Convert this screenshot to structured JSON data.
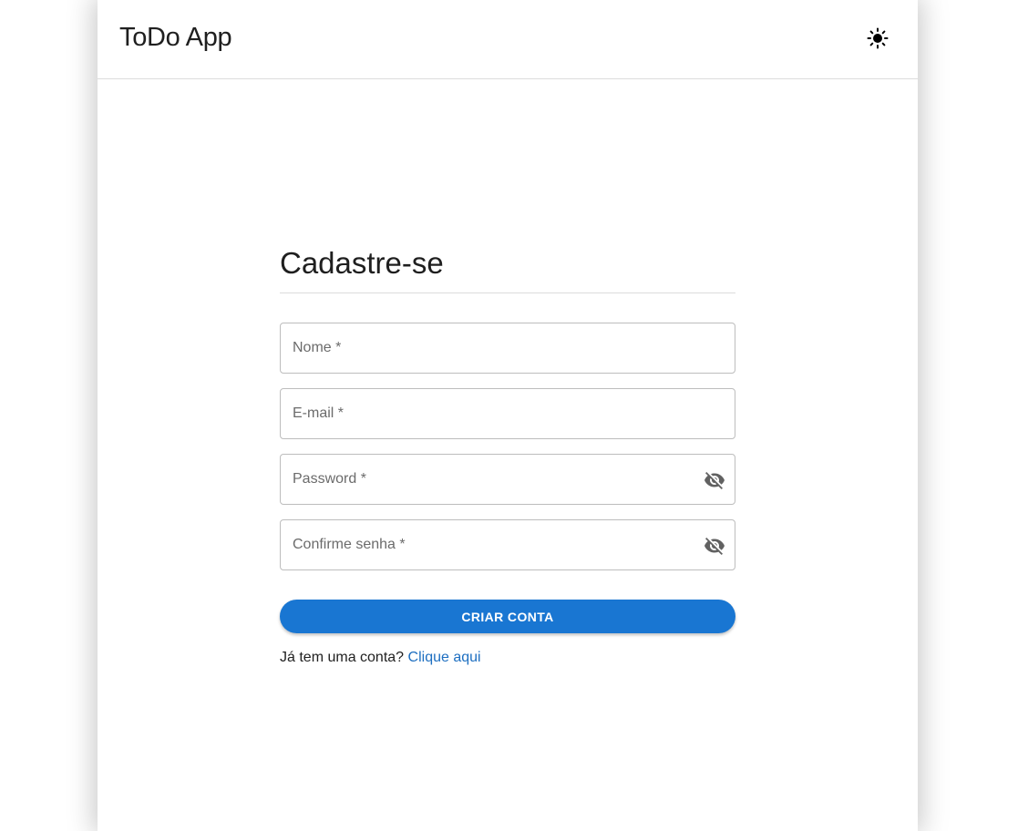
{
  "header": {
    "title": "ToDo App",
    "theme_icon": "sun-icon"
  },
  "form": {
    "heading": "Cadastre-se",
    "fields": [
      {
        "placeholder": "Nome *",
        "value": ""
      },
      {
        "placeholder": "E-mail *",
        "value": ""
      },
      {
        "placeholder": "Password *",
        "value": "",
        "icon": "eye-off-icon"
      },
      {
        "placeholder": "Confirme senha *",
        "value": "",
        "icon": "eye-off-icon"
      }
    ],
    "submit_label": "CRIAR CONTA",
    "login_prompt": "Já tem uma conta?",
    "login_link": "Clique aqui"
  },
  "colors": {
    "primary": "#1976d2",
    "link": "#1e6fc1",
    "border": "#bdbdbd",
    "placeholder": "#6b6b6b"
  }
}
